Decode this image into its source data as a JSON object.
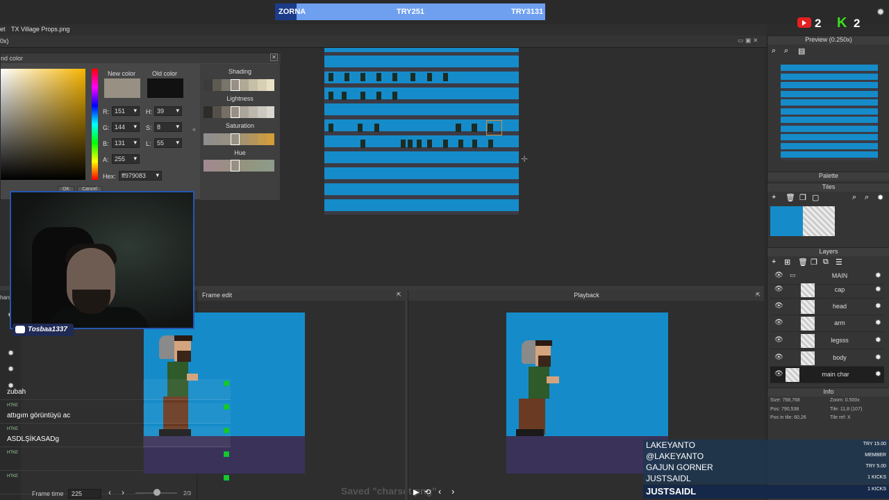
{
  "stream": {
    "goal": {
      "left": "ZORNA",
      "center": "TRY251",
      "right": "TRY3131",
      "progress": 0.08
    },
    "social": [
      {
        "icon": "youtube-icon",
        "count": "2"
      },
      {
        "icon": "kick-icon",
        "count": "2"
      }
    ]
  },
  "tabs": {
    "prefix": "et",
    "active": "TX Village Props.png"
  },
  "menubar": {
    "left": "0x)"
  },
  "color_dialog": {
    "title": "nd color",
    "new_color_label": "New color",
    "old_color_label": "Old color",
    "new_color": "#979083",
    "old_color": "#111111",
    "fields": {
      "R": "151",
      "G": "144",
      "B": "131",
      "A": "255",
      "H": "39",
      "S": "8",
      "L": "55"
    },
    "labels": {
      "R": "R:",
      "G": "G:",
      "B": "B:",
      "A": "A:",
      "H": "H:",
      "S": "S:",
      "L": "L:"
    },
    "hex_label": "Hex:",
    "hex": "ff979083",
    "shading_label": "Shading",
    "lightness_label": "Lightness",
    "saturation_label": "Saturation",
    "hue_label": "Hue",
    "buttons": {
      "ok": "OK",
      "cancel": "Cancel"
    }
  },
  "webcam": {
    "channel": "Tosbaa1337"
  },
  "frame_edit": {
    "title": "Frame edit",
    "frame_time_label": "Frame time",
    "frame_time": "225",
    "frame_count": "2/3"
  },
  "playback": {
    "title": "Playback",
    "toast": "Saved \"charset.png\""
  },
  "chat": [
    {
      "name": "",
      "msg": "zubah"
    },
    {
      "name": "HTKE",
      "msg": "attıgım görüntüyü ac"
    },
    {
      "name": "HTKE",
      "msg": "ASDLŞİKASADg"
    },
    {
      "name": "HTKE",
      "msg": ""
    },
    {
      "name": "HTKE",
      "msg": ""
    }
  ],
  "left_strip_label": "harst",
  "right_panel": {
    "preview": "Preview (0.250x)",
    "palette": "Palette",
    "tiles": "Tiles",
    "layers": "Layers",
    "layer_items": [
      {
        "name": "MAIN"
      },
      {
        "name": "cap"
      },
      {
        "name": "head"
      },
      {
        "name": "arm"
      },
      {
        "name": "legsss"
      },
      {
        "name": "body"
      },
      {
        "name": "main char"
      }
    ],
    "info_title": "Info",
    "info": {
      "size": "Size: 768,768",
      "zoom": "Zoom: 0.500x",
      "pos": "Pos: 790,538",
      "tile": "Tile: 11,8 (107)",
      "pos_in_tile": "Pos in tile: 60,26",
      "tile_ref": "Tile ref: X"
    }
  },
  "subs": [
    {
      "name": "LAKEYANTO",
      "value": "TRY 15.00"
    },
    {
      "name": "@LAKEYANTO",
      "value": "MEMBER"
    },
    {
      "name": "GAJUN GORNER",
      "value": "TRY 5.00"
    },
    {
      "name": "JUSTSAIDL",
      "value": "1 KICKS"
    },
    {
      "name": "JUSTSAIDL",
      "value": "1 KICKS"
    }
  ],
  "colors": {
    "sky": "#158cc9",
    "ground": "#3a3259",
    "accent": "#2757b5"
  }
}
